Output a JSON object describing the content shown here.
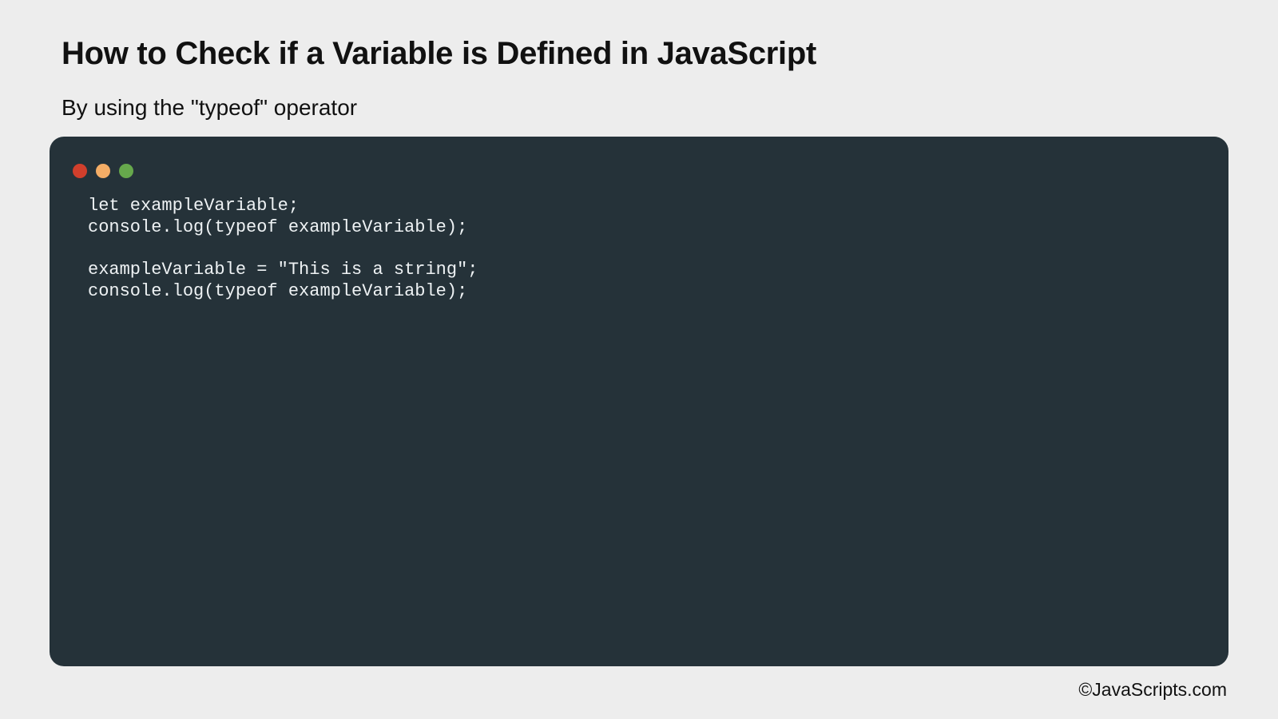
{
  "header": {
    "title": "How to Check if a Variable is Defined in JavaScript",
    "subtitle": "By using the \"typeof\" operator"
  },
  "code_window": {
    "dots": [
      {
        "name": "close",
        "color": "#d13f2c"
      },
      {
        "name": "minimize",
        "color": "#f4ad66"
      },
      {
        "name": "maximize",
        "color": "#66a84c"
      }
    ],
    "lines": [
      "let exampleVariable;",
      "console.log(typeof exampleVariable);",
      "",
      "exampleVariable = \"This is a string\";",
      "console.log(typeof exampleVariable);"
    ]
  },
  "footer": {
    "copyright": "©JavaScripts.com"
  }
}
